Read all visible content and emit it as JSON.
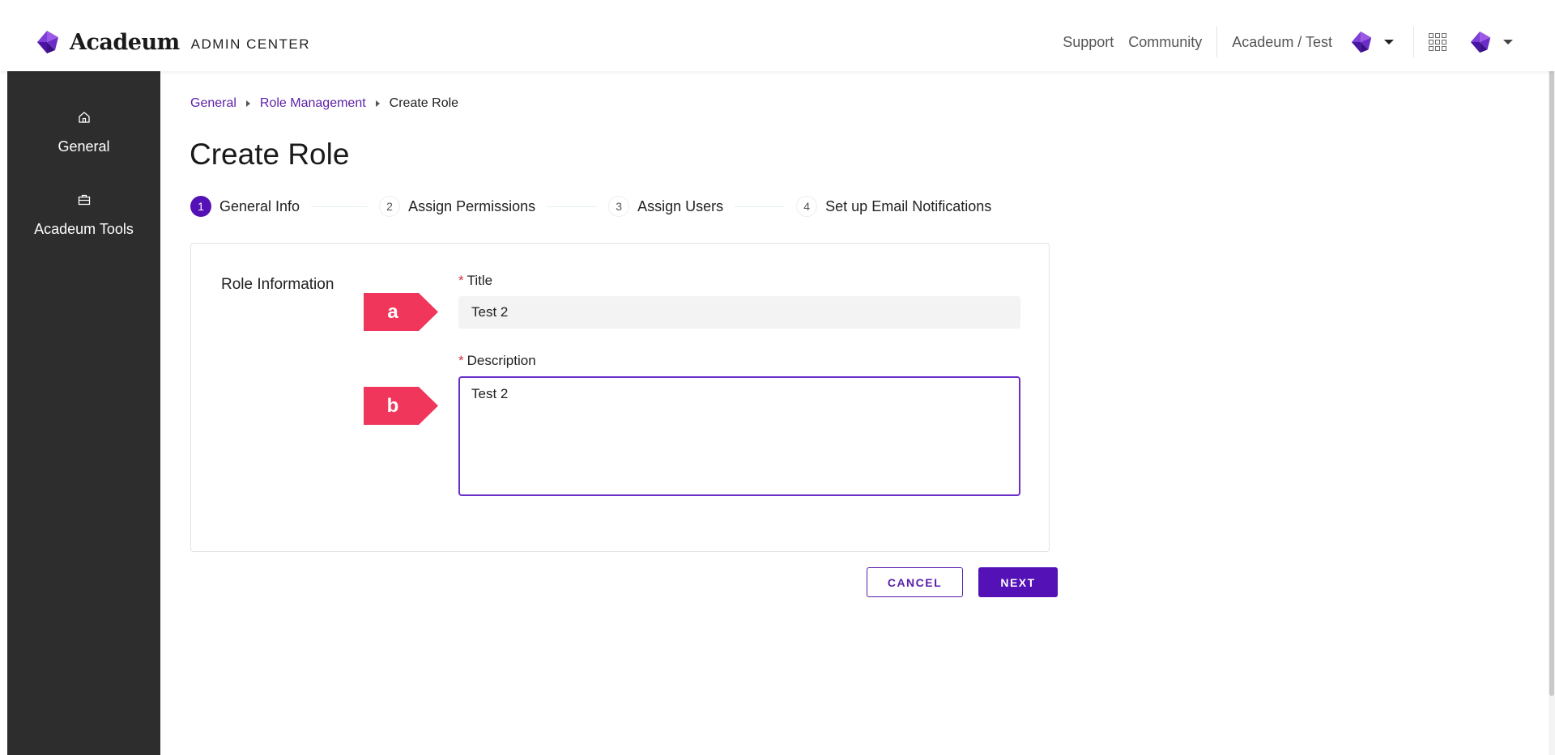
{
  "header": {
    "brand": "Acadeum",
    "subtitle": "ADMIN CENTER",
    "links": [
      "Support",
      "Community"
    ],
    "org": "Acadeum / Test",
    "icons": [
      "acadeum-logo-icon",
      "apps-grid-icon",
      "user-avatar-icon"
    ]
  },
  "sidebar": {
    "items": [
      {
        "label": "General",
        "icon": "home-icon"
      },
      {
        "label": "Acadeum Tools",
        "icon": "toolbox-icon"
      }
    ]
  },
  "breadcrumb": {
    "items": [
      "General",
      "Role Management"
    ],
    "current": "Create Role"
  },
  "page": {
    "title": "Create Role"
  },
  "stepper": {
    "steps": [
      {
        "number": "1",
        "label": "General Info"
      },
      {
        "number": "2",
        "label": "Assign Permissions"
      },
      {
        "number": "3",
        "label": "Assign Users"
      },
      {
        "number": "4",
        "label": "Set up Email Notifications"
      }
    ],
    "active_step": 1
  },
  "form": {
    "section_label": "Role Information",
    "required_marker": "*",
    "title_label": "Title",
    "title_value": "Test 2",
    "description_label": "Description",
    "description_value": "Test 2"
  },
  "annotations": [
    "a",
    "b"
  ],
  "actions": {
    "cancel": "CANCEL",
    "next": "NEXT"
  },
  "colors": {
    "accent": "#5411b5",
    "link": "#5b1ea8",
    "annotation": "#f0365b",
    "sidebar": "#2d2d2d"
  }
}
